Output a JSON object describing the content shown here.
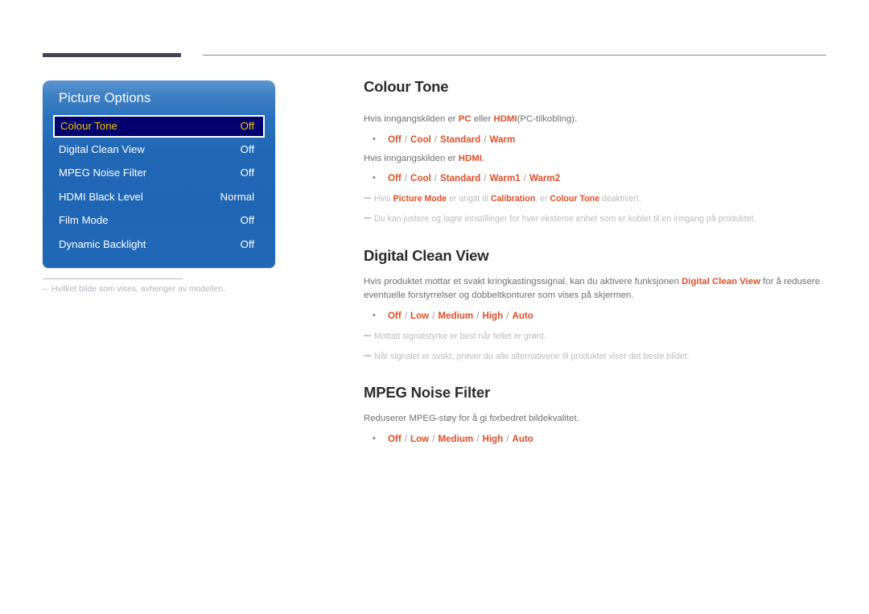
{
  "page": {
    "language": "Norwegian",
    "background_color": "#ffffff",
    "accent_color": "#e04e28",
    "rule_color": "#464150"
  },
  "osd_menu": {
    "title": "Picture Options",
    "panel_color_top": "#5d97d0",
    "panel_color_bottom": "#2169b6",
    "selected_row_background": "#00006e",
    "selected_row_text_color": "#f5c600",
    "rows": [
      {
        "label": "Colour Tone",
        "value": "Off",
        "selected": true
      },
      {
        "label": "Digital Clean View",
        "value": "Off",
        "selected": false
      },
      {
        "label": "MPEG Noise Filter",
        "value": "Off",
        "selected": false
      },
      {
        "label": "HDMI Black Level",
        "value": "Normal",
        "selected": false
      },
      {
        "label": "Film Mode",
        "value": "Off",
        "selected": false
      },
      {
        "label": "Dynamic Backlight",
        "value": "Off",
        "selected": false
      }
    ],
    "footnote": {
      "dash": "–",
      "text": "Hvilket bilde som vises, avhenger av modellen."
    }
  },
  "sections": {
    "colour_tone": {
      "title": "Colour Tone",
      "intro_1_pre": "Hvis inngangskilden er ",
      "intro_1_b1": "PC",
      "intro_1_mid": " eller ",
      "intro_1_b2": "HDMI",
      "intro_1_post": "(PC-tilkobling).",
      "options_1": {
        "o1": "Off",
        "o2": "Cool",
        "o3": "Standard",
        "o4": "Warm"
      },
      "intro_2_pre": "Hvis inngangskilden er ",
      "intro_2_b1": "HDMI",
      "intro_2_post": ".",
      "options_2": {
        "o1": "Off",
        "o2": "Cool",
        "o3": "Standard",
        "o4": "Warm1",
        "o5": "Warm2"
      },
      "note_1_pre": "Hvis ",
      "note_1_b1": "Picture Mode",
      "note_1_mid1": " er angitt til ",
      "note_1_b2": "Calibration",
      "note_1_mid2": ", er ",
      "note_1_b3": "Colour Tone",
      "note_1_post": " deaktivert.",
      "note_2": "Du kan justere og lagre innstillinger for hver eksterne enhet som er koblet til en inngang på produktet."
    },
    "digital_clean_view": {
      "title": "Digital Clean View",
      "intro_pre": "Hvis produktet mottar et svakt kringkastingssignal, kan du aktivere funksjonen ",
      "intro_b1": "Digital Clean View",
      "intro_post": " for å redusere eventuelle forstyrrelser og dobbeltkonturer som vises på skjermen.",
      "options": {
        "o1": "Off",
        "o2": "Low",
        "o3": "Medium",
        "o4": "High",
        "o5": "Auto"
      },
      "note_1": "Mottatt signalstyrke er best når feltet er grønt.",
      "note_2": "Når signalet er svakt, prøver du alle alternativene til produktet viser det beste bildet."
    },
    "mpeg_noise_filter": {
      "title": "MPEG Noise Filter",
      "intro": "Reduserer MPEG-støy for å gi forbedret bildekvalitet.",
      "options": {
        "o1": "Off",
        "o2": "Low",
        "o3": "Medium",
        "o4": "High",
        "o5": "Auto"
      }
    }
  },
  "separators": {
    "slash": "/"
  }
}
